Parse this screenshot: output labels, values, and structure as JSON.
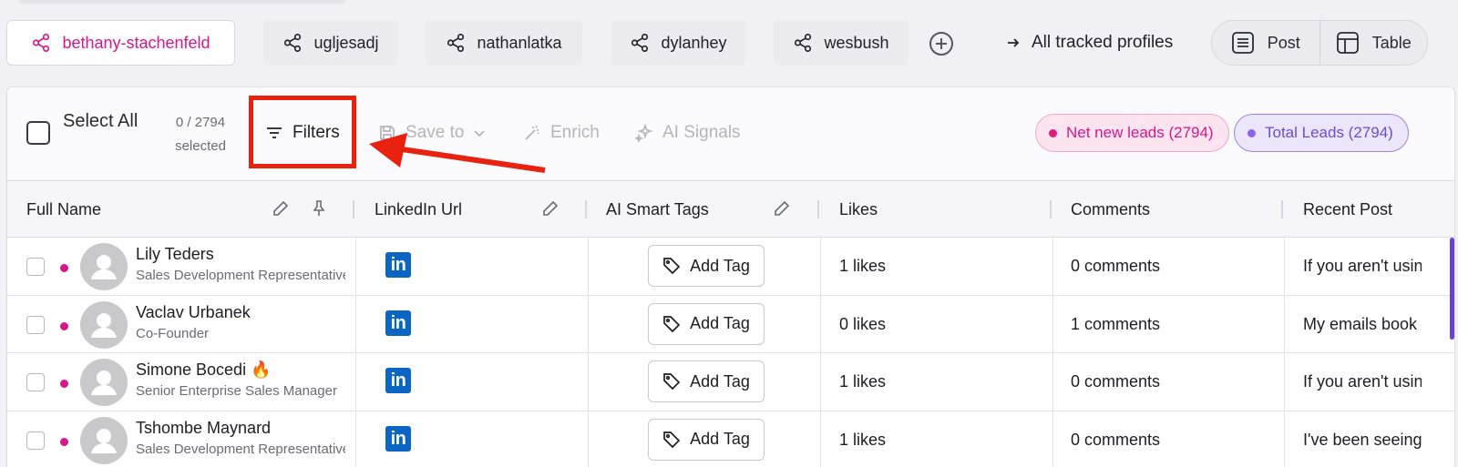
{
  "profiles": [
    {
      "name": "bethany-stachenfeld",
      "active": true
    },
    {
      "name": "ugljesadj",
      "active": false
    },
    {
      "name": "nathanlatka",
      "active": false
    },
    {
      "name": "dylanhey",
      "active": false
    },
    {
      "name": "wesbush",
      "active": false
    }
  ],
  "header": {
    "all_tracked_label": "All tracked profiles",
    "view_post_label": "Post",
    "view_table_label": "Table"
  },
  "toolbar": {
    "select_all_label": "Select All",
    "selected_count": "0 / 2794",
    "selected_suffix": "selected",
    "filters_label": "Filters",
    "save_to_label": "Save to",
    "enrich_label": "Enrich",
    "ai_signals_label": "AI Signals",
    "net_new_badge": "Net new leads (2794)",
    "total_leads_badge": "Total Leads (2794)"
  },
  "columns": {
    "full_name": "Full Name",
    "linkedin_url": "LinkedIn Url",
    "ai_smart_tags": "AI Smart Tags",
    "likes": "Likes",
    "comments": "Comments",
    "recent_post": "Recent Post"
  },
  "rows": [
    {
      "name": "Lily Teders",
      "title": "Sales Development Representative",
      "add_tag": "Add Tag",
      "likes": "1 likes",
      "comments": "0 comments",
      "recent_post": "If you aren't using"
    },
    {
      "name": "Vaclav Urbanek",
      "title": "Co-Founder",
      "add_tag": "Add Tag",
      "likes": "0 likes",
      "comments": "1 comments",
      "recent_post": "My emails book"
    },
    {
      "name": "Simone Bocedi 🔥",
      "title": "Senior Enterprise Sales Manager",
      "add_tag": "Add Tag",
      "likes": "1 likes",
      "comments": "0 comments",
      "recent_post": "If you aren't using"
    },
    {
      "name": "Tshombe Maynard",
      "title": "Sales Development Representative",
      "add_tag": "Add Tag",
      "likes": "1 likes",
      "comments": "0 comments",
      "recent_post": "I've been seeing"
    }
  ],
  "linkedin_icon_text": "in",
  "colors": {
    "accent_pink": "#d6178a",
    "accent_purple": "#6d4bd6",
    "linkedin_blue": "#0a66c2",
    "annotation_red": "#e8220f"
  }
}
